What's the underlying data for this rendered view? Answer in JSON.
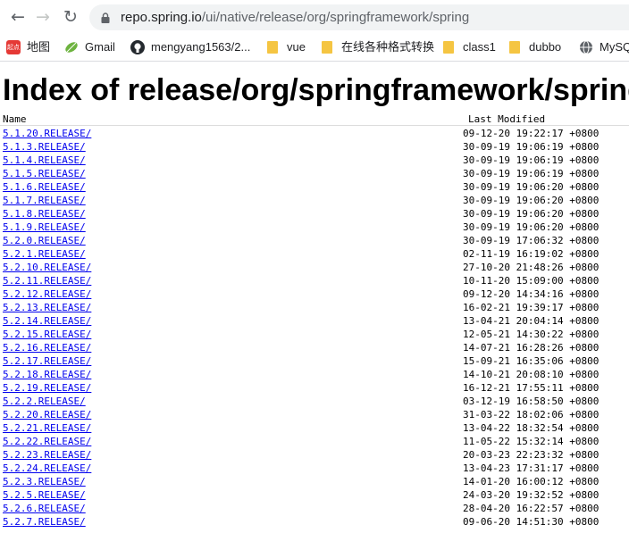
{
  "browser": {
    "url_host": "repo.spring.io",
    "url_path": "/ui/native/release/org/springframework/spring"
  },
  "bookmarks": [
    {
      "label": "地图",
      "icon": "map-app-icon",
      "badge": "起点"
    },
    {
      "label": "Gmail",
      "icon": "leaf-icon"
    },
    {
      "label": "mengyang1563/2...",
      "icon": "github-icon"
    },
    {
      "label": "vue",
      "icon": "folder-icon"
    },
    {
      "label": "在线各种格式转换",
      "icon": "folder-icon"
    },
    {
      "label": "class1",
      "icon": "folder-icon"
    },
    {
      "label": "dubbo",
      "icon": "folder-icon"
    },
    {
      "label": "MySQ",
      "icon": "globe-icon"
    }
  ],
  "page": {
    "title": "Index of release/org/springframework/spring",
    "col_name": "Name",
    "col_modified": "Last Modified"
  },
  "rows": [
    {
      "name": "5.1.20.RELEASE/",
      "date": "09-12-20 19:22:17 +0800"
    },
    {
      "name": "5.1.3.RELEASE/",
      "date": "30-09-19 19:06:19 +0800"
    },
    {
      "name": "5.1.4.RELEASE/",
      "date": "30-09-19 19:06:19 +0800"
    },
    {
      "name": "5.1.5.RELEASE/",
      "date": "30-09-19 19:06:19 +0800"
    },
    {
      "name": "5.1.6.RELEASE/",
      "date": "30-09-19 19:06:20 +0800"
    },
    {
      "name": "5.1.7.RELEASE/",
      "date": "30-09-19 19:06:20 +0800"
    },
    {
      "name": "5.1.8.RELEASE/",
      "date": "30-09-19 19:06:20 +0800"
    },
    {
      "name": "5.1.9.RELEASE/",
      "date": "30-09-19 19:06:20 +0800"
    },
    {
      "name": "5.2.0.RELEASE/",
      "date": "30-09-19 17:06:32 +0800"
    },
    {
      "name": "5.2.1.RELEASE/",
      "date": "02-11-19 16:19:02 +0800"
    },
    {
      "name": "5.2.10.RELEASE/",
      "date": "27-10-20 21:48:26 +0800"
    },
    {
      "name": "5.2.11.RELEASE/",
      "date": "10-11-20 15:09:00 +0800"
    },
    {
      "name": "5.2.12.RELEASE/",
      "date": "09-12-20 14:34:16 +0800"
    },
    {
      "name": "5.2.13.RELEASE/",
      "date": "16-02-21 19:39:17 +0800"
    },
    {
      "name": "5.2.14.RELEASE/",
      "date": "13-04-21 20:04:14 +0800"
    },
    {
      "name": "5.2.15.RELEASE/",
      "date": "12-05-21 14:30:22 +0800"
    },
    {
      "name": "5.2.16.RELEASE/",
      "date": "14-07-21 16:28:26 +0800"
    },
    {
      "name": "5.2.17.RELEASE/",
      "date": "15-09-21 16:35:06 +0800"
    },
    {
      "name": "5.2.18.RELEASE/",
      "date": "14-10-21 20:08:10 +0800"
    },
    {
      "name": "5.2.19.RELEASE/",
      "date": "16-12-21 17:55:11 +0800"
    },
    {
      "name": "5.2.2.RELEASE/",
      "date": "03-12-19 16:58:50 +0800"
    },
    {
      "name": "5.2.20.RELEASE/",
      "date": "31-03-22 18:02:06 +0800"
    },
    {
      "name": "5.2.21.RELEASE/",
      "date": "13-04-22 18:32:54 +0800"
    },
    {
      "name": "5.2.22.RELEASE/",
      "date": "11-05-22 15:32:14 +0800"
    },
    {
      "name": "5.2.23.RELEASE/",
      "date": "20-03-23 22:23:32 +0800"
    },
    {
      "name": "5.2.24.RELEASE/",
      "date": "13-04-23 17:31:17 +0800"
    },
    {
      "name": "5.2.3.RELEASE/",
      "date": "14-01-20 16:00:12 +0800"
    },
    {
      "name": "5.2.5.RELEASE/",
      "date": "24-03-20 19:32:52 +0800"
    },
    {
      "name": "5.2.6.RELEASE/",
      "date": "28-04-20 16:22:57 +0800"
    },
    {
      "name": "5.2.7.RELEASE/",
      "date": "09-06-20 14:51:30 +0800"
    }
  ]
}
